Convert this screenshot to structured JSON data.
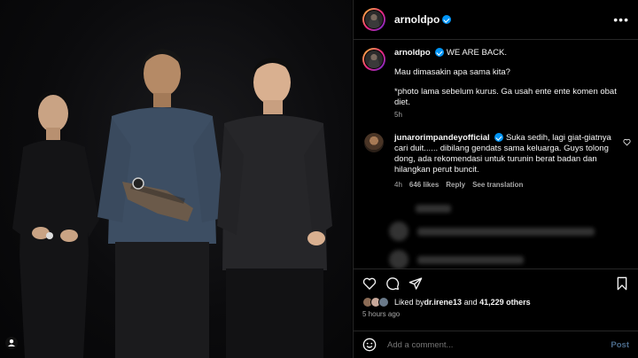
{
  "post": {
    "username": "arnoldpo",
    "more_icon": "more-horizontal-icon"
  },
  "caption": {
    "username": "arnoldpo",
    "title": "WE ARE BACK.",
    "line1": "Mau dimasakin apa sama kita?",
    "line2": "*photo lama sebelum kurus. Ga usah ente ente komen obat diet.",
    "time": "5h"
  },
  "comment": {
    "username": "junarorimpandeyofficial",
    "text": "Suka sedih, lagi giat-giatnya cari duit...... dibilang gendats sama keluarga. Guys tolong dong, ada rekomendasi untuk turunin berat badan dan hilangkan perut buncit.",
    "time": "4h",
    "likes": "646 likes",
    "reply": "Reply",
    "translate": "See translation"
  },
  "likes": {
    "prefix": "Liked by ",
    "user": "dr.irene13",
    "middle": " and ",
    "count": "41,229 others"
  },
  "ago": "5 hours ago",
  "add_comment": {
    "placeholder": "Add a comment...",
    "post": "Post"
  },
  "colors": {
    "verified": "#0095f6",
    "secondary_text": "#a8a8a8",
    "border": "#262626"
  }
}
